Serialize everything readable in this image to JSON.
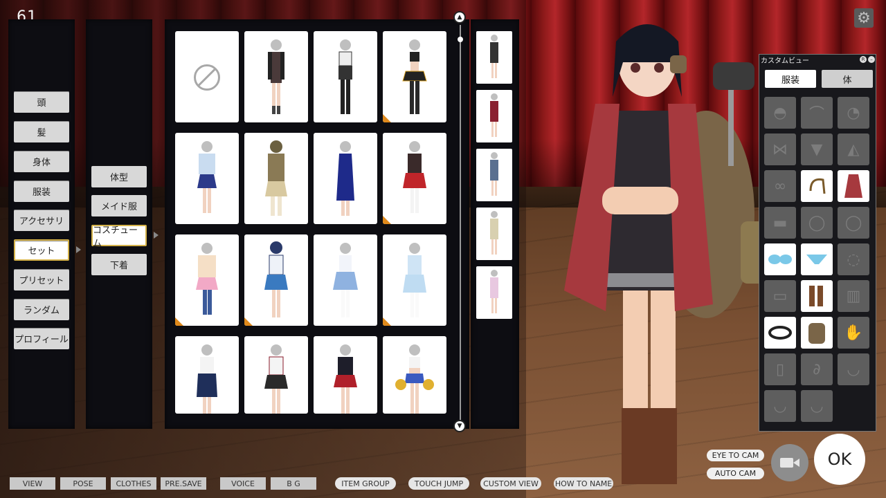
{
  "counter": "61",
  "settings_icon": "gear-icon",
  "main_menu": [
    {
      "label": "頭"
    },
    {
      "label": "髪"
    },
    {
      "label": "身体"
    },
    {
      "label": "服装"
    },
    {
      "label": "アクセサリ"
    },
    {
      "label": "セット",
      "active": true
    },
    {
      "label": "プリセット"
    },
    {
      "label": "ランダム"
    },
    {
      "label": "プロフィール"
    }
  ],
  "sub_menu": [
    {
      "label": "体型"
    },
    {
      "label": "メイド服"
    },
    {
      "label": "コスチューム",
      "active": true
    },
    {
      "label": "下着"
    }
  ],
  "custom_view": {
    "title": "カスタムビュー",
    "tabs": [
      "服装",
      "体"
    ]
  },
  "bottom_bar": {
    "view": "VIEW",
    "pose": "POSE",
    "clothes": "CLOTHES",
    "pre_save": "PRE.SAVE",
    "voice": "VOICE",
    "bg": "B G",
    "item_group": "ITEM GROUP",
    "touch_jump": "TOUCH JUMP",
    "custom_view": "CUSTOM VIEW",
    "how_to_name": "HOW TO NAME"
  },
  "camera": {
    "eye_to_cam": "EYE TO CAM",
    "auto_cam": "AUTO CAM"
  },
  "ok_label": "OK",
  "colors": {
    "accent_border": "#d4b24a",
    "tag_orange": "#e08a1c",
    "panel_dark": "#0d0d12"
  }
}
